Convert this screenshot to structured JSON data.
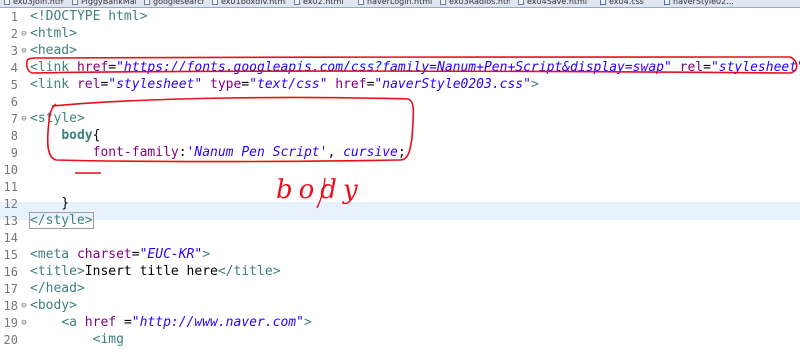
{
  "tabs": [
    {
      "label": "ex03Join.html",
      "icon": "html-file-icon"
    },
    {
      "label": "PiggyBankMai...",
      "icon": "file-icon"
    },
    {
      "label": "googlesearch...",
      "icon": "html-file-icon"
    },
    {
      "label": "ex01boxdiv.html",
      "icon": "html-file-icon"
    },
    {
      "label": "ex02.html",
      "icon": "html-file-icon"
    },
    {
      "label": "naverLogin.html",
      "icon": "html-file-icon"
    },
    {
      "label": "ex03Radios.html",
      "icon": "html-file-icon"
    },
    {
      "label": "ex04Save.html",
      "icon": "html-file-icon"
    },
    {
      "label": "ex04.css",
      "icon": "css-file-icon"
    },
    {
      "label": "naverStyle02...",
      "icon": "css-file-icon"
    }
  ],
  "editor": {
    "active_line": 13,
    "lines": [
      {
        "n": "1",
        "fold": "",
        "tokens": [
          {
            "t": "<!DOCTYPE html>",
            "c": "tagc"
          }
        ]
      },
      {
        "n": "2",
        "fold": "⊖",
        "tokens": [
          {
            "t": "<html>",
            "c": "tagc"
          }
        ]
      },
      {
        "n": "3",
        "fold": "⊖",
        "tokens": [
          {
            "t": "<head>",
            "c": "tagc"
          }
        ]
      },
      {
        "n": "4",
        "fold": "",
        "tokens": [
          {
            "t": "<",
            "c": "tagc"
          },
          {
            "t": "link ",
            "c": "tagc"
          },
          {
            "t": "href",
            "c": "attr"
          },
          {
            "t": "=",
            "c": "txt"
          },
          {
            "t": "\"https://fonts.googleapis.com/css?family=Nanum+Pen+Script&display=swap\"",
            "c": "val"
          },
          {
            "t": " ",
            "c": "txt"
          },
          {
            "t": "rel",
            "c": "attr"
          },
          {
            "t": "=",
            "c": "txt"
          },
          {
            "t": "\"stylesheet\"",
            "c": "val"
          },
          {
            "t": ">",
            "c": "tagc"
          }
        ]
      },
      {
        "n": "5",
        "fold": "",
        "tokens": [
          {
            "t": "<link ",
            "c": "tagc"
          },
          {
            "t": "rel",
            "c": "attr"
          },
          {
            "t": "=",
            "c": "txt"
          },
          {
            "t": "\"stylesheet\"",
            "c": "val"
          },
          {
            "t": " ",
            "c": "txt"
          },
          {
            "t": "type",
            "c": "attr"
          },
          {
            "t": "=",
            "c": "txt"
          },
          {
            "t": "\"text/css\"",
            "c": "val"
          },
          {
            "t": " ",
            "c": "txt"
          },
          {
            "t": "href",
            "c": "attr"
          },
          {
            "t": "=",
            "c": "txt"
          },
          {
            "t": "\"naverStyle0203.css\"",
            "c": "val"
          },
          {
            "t": ">",
            "c": "tagc"
          }
        ]
      },
      {
        "n": "6",
        "fold": "",
        "tokens": []
      },
      {
        "n": "7",
        "fold": "⊖",
        "tokens": [
          {
            "t": "<style>",
            "c": "tagc"
          }
        ]
      },
      {
        "n": "8",
        "fold": "",
        "tokens": [
          {
            "t": "    ",
            "c": "ws"
          },
          {
            "t": "body",
            "c": "sel"
          },
          {
            "t": "{",
            "c": "txt"
          }
        ]
      },
      {
        "n": "9",
        "fold": "",
        "tokens": [
          {
            "t": "        ",
            "c": "ws"
          },
          {
            "t": "font-family",
            "c": "prop"
          },
          {
            "t": ":",
            "c": "txt"
          },
          {
            "t": "'Nanum Pen Script'",
            "c": "cval"
          },
          {
            "t": ", ",
            "c": "txt"
          },
          {
            "t": "cursive",
            "c": "cval"
          },
          {
            "t": ";",
            "c": "txt"
          }
        ]
      },
      {
        "n": "10",
        "fold": "",
        "tokens": []
      },
      {
        "n": "11",
        "fold": "",
        "tokens": []
      },
      {
        "n": "12",
        "fold": "",
        "tokens": [
          {
            "t": "    }",
            "c": "txt"
          }
        ]
      },
      {
        "n": "13",
        "fold": "",
        "tokens": [
          {
            "t": "</style>",
            "c": "tagc"
          }
        ]
      },
      {
        "n": "14",
        "fold": "",
        "tokens": []
      },
      {
        "n": "15",
        "fold": "",
        "tokens": [
          {
            "t": "<meta ",
            "c": "tagc"
          },
          {
            "t": "charset",
            "c": "attr"
          },
          {
            "t": "=",
            "c": "txt"
          },
          {
            "t": "\"EUC-KR\"",
            "c": "val"
          },
          {
            "t": ">",
            "c": "tagc"
          }
        ]
      },
      {
        "n": "16",
        "fold": "",
        "tokens": [
          {
            "t": "<title>",
            "c": "tagc"
          },
          {
            "t": "Insert title here",
            "c": "txt"
          },
          {
            "t": "</title>",
            "c": "tagc"
          }
        ]
      },
      {
        "n": "17",
        "fold": "",
        "tokens": [
          {
            "t": "</head>",
            "c": "tagc"
          }
        ]
      },
      {
        "n": "18",
        "fold": "⊖",
        "tokens": [
          {
            "t": "<body>",
            "c": "tagc"
          }
        ]
      },
      {
        "n": "19",
        "fold": "⊖",
        "tokens": [
          {
            "t": "    ",
            "c": "ws"
          },
          {
            "t": "<a ",
            "c": "tagc"
          },
          {
            "t": "href ",
            "c": "attr"
          },
          {
            "t": "=",
            "c": "txt"
          },
          {
            "t": "\"http://www.naver.com\"",
            "c": "val"
          },
          {
            "t": ">",
            "c": "tagc"
          }
        ]
      },
      {
        "n": "20",
        "fold": "",
        "tokens": [
          {
            "t": "        <img",
            "c": "tagc"
          }
        ]
      }
    ]
  },
  "annotations": {
    "handwriting": "body",
    "ink_color": "#e8101c"
  }
}
